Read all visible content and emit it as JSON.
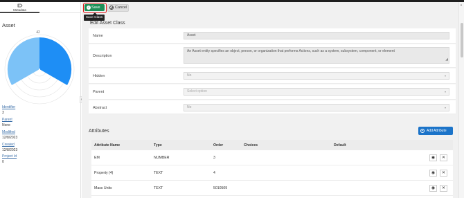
{
  "sidebar": {
    "tab_label": "Metadata",
    "tab_icon": "tag-icon",
    "title": "Asset",
    "radar_max_label": "42",
    "properties": [
      {
        "key": "Identifier",
        "value": "3"
      },
      {
        "key": "Parent",
        "value": "None"
      },
      {
        "key": "Modified",
        "value": "12/8/2023"
      },
      {
        "key": "Created",
        "value": "12/8/2023"
      },
      {
        "key": "Project Id",
        "value": "0"
      }
    ]
  },
  "toolbar": {
    "save_label": "Save",
    "cancel_label": "Cancel",
    "tooltip": "Save Class"
  },
  "form": {
    "title": "Edit Asset Class",
    "name_label": "Name",
    "name_value": "Asset",
    "description_label": "Description",
    "description_value": "An Asset entity specifies an object, person, or organization that performs Actions, such as a system, subsystem, component, or element",
    "hidden_label": "Hidden",
    "hidden_value": "No",
    "parent_label": "Parent",
    "parent_placeholder": "Select option",
    "abstract_label": "Abstract",
    "abstract_value": "No"
  },
  "attributes": {
    "title": "Attributes",
    "add_label": "Add Attribute",
    "columns": [
      "Attribute Name",
      "Type",
      "Order",
      "Choices",
      "Default"
    ],
    "rows": [
      {
        "name": "EM",
        "type": "NUMBER",
        "order": "3",
        "choices": "",
        "default": ""
      },
      {
        "name": "Property (4)",
        "type": "TEXT",
        "order": "4",
        "choices": "",
        "default": ""
      },
      {
        "name": "Mass Units",
        "type": "TEXT",
        "order": "5010509",
        "choices": "",
        "default": ""
      }
    ]
  },
  "colors": {
    "save": "#1f8f57",
    "add": "#1c74c9",
    "radar_dark": "#1e8ef5",
    "radar_light": "#7cc2f7",
    "highlight_border": "#dd1111"
  }
}
